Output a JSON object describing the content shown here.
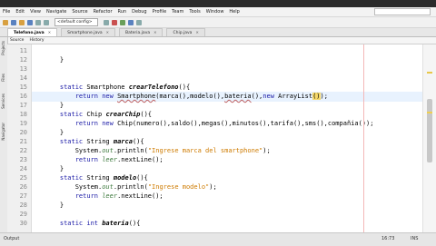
{
  "menu": {
    "items": [
      "File",
      "Edit",
      "View",
      "Navigate",
      "Source",
      "Refactor",
      "Run",
      "Debug",
      "Profile",
      "Team",
      "Tools",
      "Window",
      "Help"
    ]
  },
  "toolbar": {
    "config": "<default config>"
  },
  "tabs": [
    {
      "label": "Telefono.java",
      "active": true
    },
    {
      "label": "Smartphone.java",
      "active": false
    },
    {
      "label": "Bateria.java",
      "active": false
    },
    {
      "label": "Chip.java",
      "active": false
    }
  ],
  "subtabs": {
    "source": "Source",
    "history": "History"
  },
  "sidebar": {
    "items": [
      "Projects",
      "Files",
      "Services",
      "Navigator"
    ]
  },
  "editor": {
    "line_numbers": [
      "11",
      "12",
      "13",
      "14",
      "15",
      "16",
      "17",
      "18",
      "19",
      "20",
      "21",
      "22",
      "23",
      "24",
      "25",
      "26",
      "27",
      "28",
      "29",
      "30"
    ]
  },
  "colors": {
    "keyword": "#1a1aa6",
    "string": "#ce7b00",
    "field": "#3e7a3e",
    "current_line": "#e8f2fe",
    "matching_brace": "#f5d86a"
  },
  "status": {
    "output": "Output",
    "position": "16:73",
    "insert_mode": "INS"
  }
}
